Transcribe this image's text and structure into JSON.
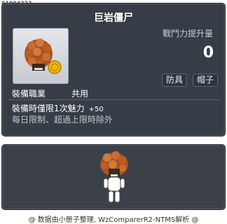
{
  "item_id": "01004323",
  "item_name": "巨岩僵尸",
  "combat": {
    "label": "戰鬥力提升量",
    "value": "0"
  },
  "tags": [
    "防具",
    "帽子"
  ],
  "job": {
    "label": "裝備職業",
    "value": "共用"
  },
  "effect": {
    "text": "裝備時僅限1次魅力",
    "bonus": "+50"
  },
  "description": "每日限制、超過上限時除外",
  "footer": "@ 数据由小册子整理, WzComparerR2-NTMS解析 @",
  "colors": {
    "panel": "#373d46",
    "rock": "#a9521f",
    "rock_light": "#d17a3a"
  }
}
